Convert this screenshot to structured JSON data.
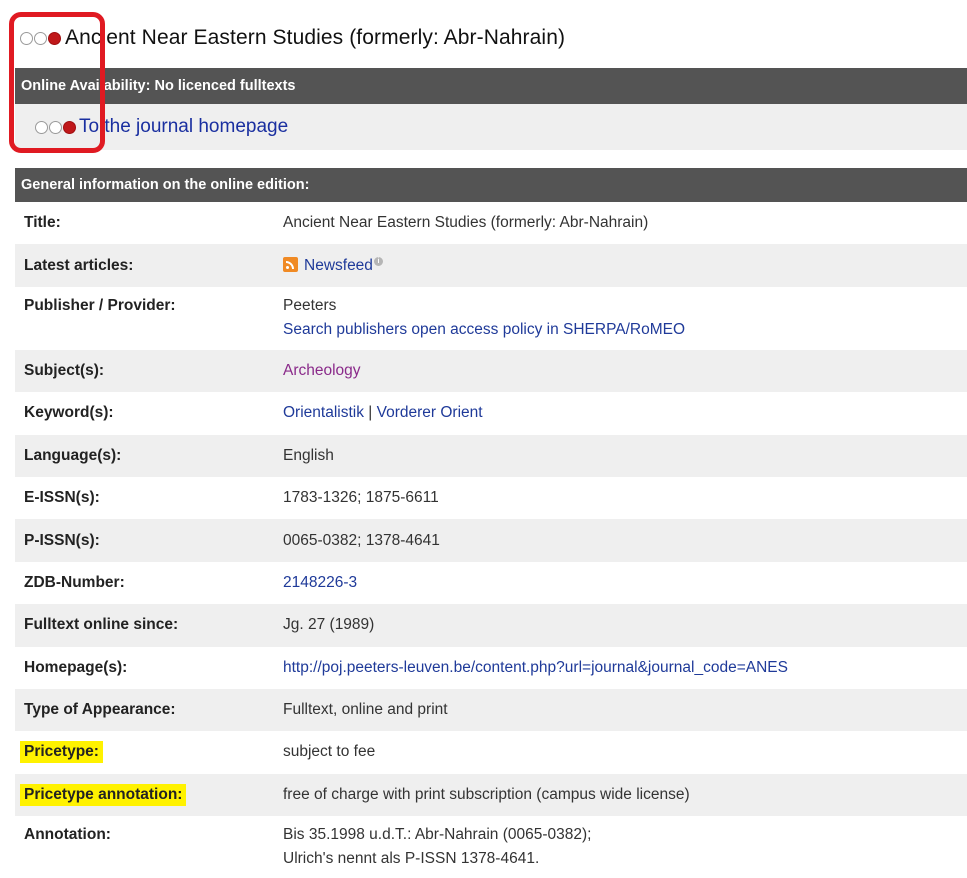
{
  "journal": {
    "title": "Ancient Near Eastern Studies (formerly: Abr-Nahrain)"
  },
  "availability": {
    "bar_text": "Online Availability: No licenced fulltexts",
    "homepage_link": "To the journal homepage"
  },
  "general": {
    "bar_text": "General information on the online edition:"
  },
  "fields": {
    "title": {
      "label": "Title:",
      "value": "Ancient Near Eastern Studies (formerly: Abr-Nahrain)"
    },
    "latest": {
      "label": "Latest articles:",
      "value": "Newsfeed",
      "icon": "rss-feed-icon"
    },
    "publisher": {
      "label": "Publisher / Provider:",
      "value": "Peeters",
      "link": "Search publishers open access policy in SHERPA/RoMEO"
    },
    "subjects": {
      "label": "Subject(s):",
      "value": "Archeology"
    },
    "keywords": {
      "label": "Keyword(s):",
      "value1": "Orientalistik",
      "sep": "|",
      "value2": "Vorderer Orient"
    },
    "language": {
      "label": "Language(s):",
      "value": "English"
    },
    "eissn": {
      "label": "E-ISSN(s):",
      "value": "1783-1326; 1875-6611"
    },
    "pissn": {
      "label": "P-ISSN(s):",
      "value": "0065-0382; 1378-4641"
    },
    "zdb": {
      "label": "ZDB-Number:",
      "value": "2148226-3"
    },
    "fulltext_since": {
      "label": "Fulltext online since:",
      "value": "Jg. 27 (1989)"
    },
    "homepages": {
      "label": "Homepage(s):",
      "value": "http://poj.peeters-leuven.be/content.php?url=journal&journal_code=ANES"
    },
    "appearance": {
      "label": "Type of Appearance:",
      "value": "Fulltext, online and print"
    },
    "pricetype": {
      "label": "Pricetype:",
      "value": "subject to fee"
    },
    "pricetype_annotation": {
      "label": "Pricetype annotation:",
      "value": "free of charge with print subscription (campus wide license)"
    },
    "annotation": {
      "label": "Annotation:",
      "line1": "Bis 35.1998 u.d.T.: Abr-Nahrain (0065-0382);",
      "line2": "Ulrich's nennt als P-ISSN 1378-4641."
    }
  },
  "colors": {
    "traffic_light_on": "#c0181a",
    "bar_bg": "#545454",
    "link": "#1f3a99",
    "visited_link": "#8a2a8a",
    "highlight": "#fff200",
    "annotation_box": "#e01a22"
  }
}
